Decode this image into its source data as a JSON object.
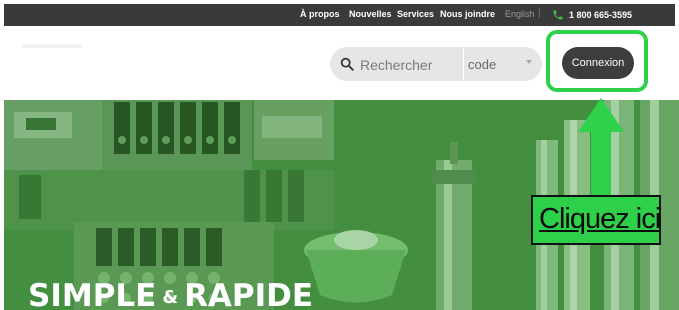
{
  "topbar": {
    "links": [
      "À propos",
      "Nouvelles",
      "Services",
      "Nous joindre"
    ],
    "language": "English",
    "separator": "|",
    "phone": "1 800 665-3595",
    "phone_icon": "phone-icon"
  },
  "header": {
    "search": {
      "icon": "search-icon",
      "placeholder": "Rechercher",
      "mode": "code"
    },
    "login_label": "Connexion"
  },
  "hero": {
    "title_part1": "SIMPLE",
    "title_amp": "&",
    "title_part2": "RAPIDE"
  },
  "annotation": {
    "label": "Cliquez ici",
    "highlight_color": "#2dd14a"
  },
  "colors": {
    "topbar_bg": "#3a3a3a",
    "button_bg": "#3d3d3d",
    "hero_tint": "#3f9a3c"
  }
}
